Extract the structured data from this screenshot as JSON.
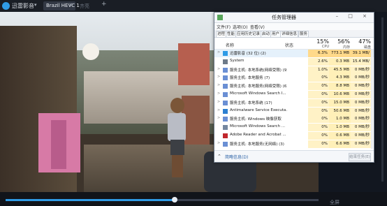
{
  "player": {
    "app_name": "迅雷影音",
    "dropdown_icon": "chevron-down-icon",
    "tabs": [
      {
        "label": "Brazil HEVC 1",
        "close": "×"
      },
      {
        "label": "齐亮"
      }
    ],
    "add_tab": "+",
    "progress": 0.54,
    "bottom_label": "全屏"
  },
  "task_manager": {
    "title": "任务管理器",
    "window_controls": "– □ ×",
    "menu": [
      "文件(F)",
      "选项(O)",
      "查看(V)"
    ],
    "tabs": [
      "进程",
      "性能",
      "应用历史记录",
      "启动",
      "用户",
      "详细信息",
      "服务"
    ],
    "columns": {
      "name": "名称",
      "status": "状态",
      "cpu": {
        "pct": "15%",
        "label": "CPU"
      },
      "mem": {
        "pct": "56%",
        "label": "内存"
      },
      "disk": {
        "pct": "47%",
        "label": "磁盘"
      }
    },
    "rows": [
      {
        "expand": ">",
        "icon_color": "#2f9be6",
        "name": "迅雷影音 (32 位) (2)",
        "status": "",
        "cpu": "6.3%",
        "mem": "773.1 MB",
        "disk": "39.1 MB/秒"
      },
      {
        "expand": "",
        "icon_color": "#6d7a89",
        "name": "System",
        "status": "",
        "cpu": "2.6%",
        "mem": "0.3 MB",
        "disk": "15.4 MB/秒"
      },
      {
        "expand": ">",
        "icon_color": "#6a8fd4",
        "name": "服务主机: 本地系统(网络受限) (9)",
        "status": "",
        "cpu": "1.0%",
        "mem": "45.5 MB",
        "disk": "0 MB/秒"
      },
      {
        "expand": ">",
        "icon_color": "#6a8fd4",
        "name": "服务主机: 本地服务 (7)",
        "status": "",
        "cpu": "0%",
        "mem": "4.3 MB",
        "disk": "0 MB/秒"
      },
      {
        "expand": ">",
        "icon_color": "#6a8fd4",
        "name": "服务主机: 本地服务(网络受限) (6)",
        "status": "",
        "cpu": "0%",
        "mem": "8.8 MB",
        "disk": "0 MB/秒"
      },
      {
        "expand": ">",
        "icon_color": "#6a8fd4",
        "name": "Microsoft Windows Search I...",
        "status": "",
        "cpu": "0%",
        "mem": "10.6 MB",
        "disk": "0 MB/秒"
      },
      {
        "expand": ">",
        "icon_color": "#6a8fd4",
        "name": "服务主机: 本地系统 (17)",
        "status": "",
        "cpu": "0%",
        "mem": "15.0 MB",
        "disk": "0 MB/秒"
      },
      {
        "expand": ">",
        "icon_color": "#2c7fd1",
        "name": "Antimalware Service Executa...",
        "status": "",
        "cpu": "0%",
        "mem": "50.6 MB",
        "disk": "0 MB/秒"
      },
      {
        "expand": ">",
        "icon_color": "#6a8fd4",
        "name": "服务主机: Windows 映像获取",
        "status": "",
        "cpu": "0%",
        "mem": "1.0 MB",
        "disk": "0 MB/秒"
      },
      {
        "expand": "",
        "icon_color": "#7487a0",
        "name": "Microsoft Windows Search ...",
        "status": "",
        "cpu": "0%",
        "mem": "1.0 MB",
        "disk": "0 MB/秒"
      },
      {
        "expand": "",
        "icon_color": "#c1272d",
        "name": "Adobe Reader and Acrobat ...",
        "status": "",
        "cpu": "0%",
        "mem": "0.6 MB",
        "disk": "0 MB/秒"
      },
      {
        "expand": ">",
        "icon_color": "#6a8fd4",
        "name": "服务主机: 本地服务(无网络) (3)",
        "status": "",
        "cpu": "0%",
        "mem": "6.6 MB",
        "disk": "0 MB/秒"
      }
    ],
    "footer": {
      "summary": "简略信息(D)",
      "end_task": "结束任务(E)"
    }
  }
}
